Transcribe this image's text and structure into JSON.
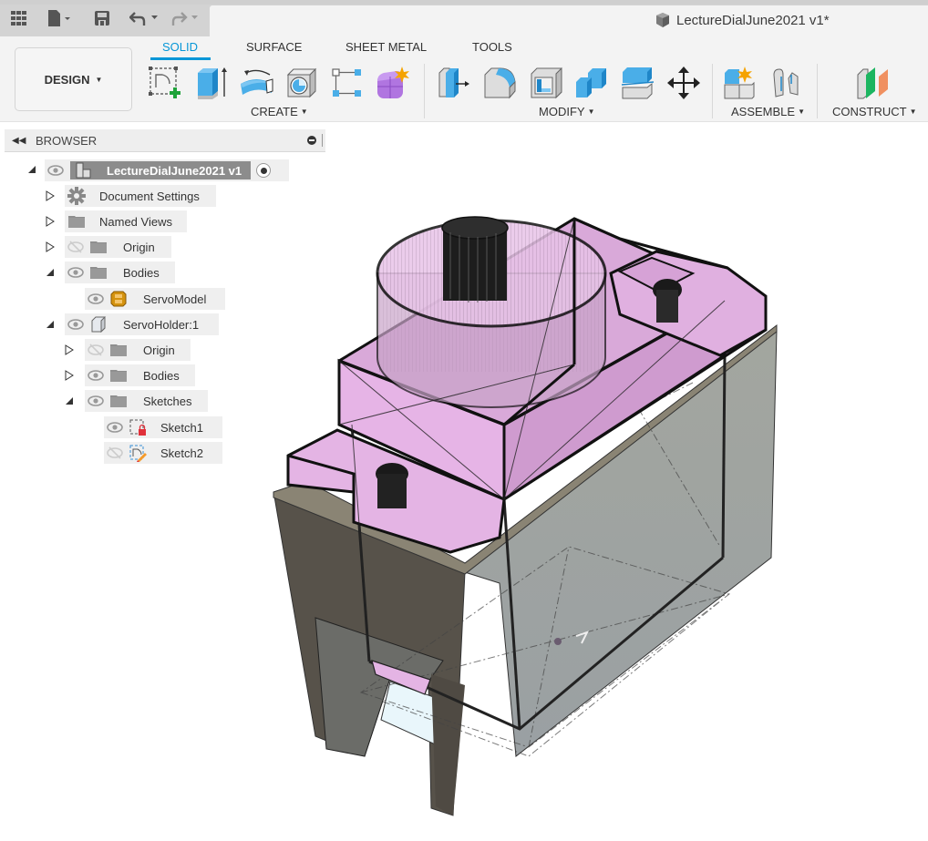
{
  "app": {
    "document_title": "LectureDialJune2021 v1*"
  },
  "quick_access": {
    "icons": [
      "grid-icon",
      "file-icon",
      "save-icon",
      "undo-icon",
      "redo-icon"
    ]
  },
  "workspace": {
    "label": "DESIGN"
  },
  "tabs": [
    {
      "label": "SOLID",
      "active": true
    },
    {
      "label": "SURFACE",
      "active": false
    },
    {
      "label": "SHEET METAL",
      "active": false
    },
    {
      "label": "TOOLS",
      "active": false
    }
  ],
  "toolbar_groups": [
    {
      "label": "CREATE",
      "tools": [
        "create-sketch",
        "extrude",
        "revolve",
        "hole",
        "rectangular-pattern",
        "create-form"
      ]
    },
    {
      "label": "MODIFY",
      "tools": [
        "press-pull",
        "fillet",
        "shell",
        "combine",
        "split-body",
        "move-copy"
      ]
    },
    {
      "label": "ASSEMBLE",
      "tools": [
        "new-component",
        "joint"
      ]
    },
    {
      "label": "CONSTRUCT",
      "tools": [
        "offset-plane"
      ]
    }
  ],
  "colors": {
    "accent": "#0696d7",
    "tool_blue": "#4aaee8",
    "servo_pink": "#e8b8e8",
    "holder_gray": "#9a9d96",
    "holder_dark": "#5c574e"
  },
  "browser": {
    "title": "BROWSER",
    "root": {
      "label": "LectureDialJune2021 v1"
    },
    "items": [
      {
        "label": "Document Settings",
        "icon": "gear-icon",
        "expander": "collapsed",
        "eye": "none"
      },
      {
        "label": "Named Views",
        "icon": "folder-icon",
        "expander": "collapsed",
        "eye": "none"
      },
      {
        "label": "Origin",
        "icon": "folder-icon",
        "expander": "collapsed",
        "eye": "hidden"
      },
      {
        "label": "Bodies",
        "icon": "folder-icon",
        "expander": "expanded",
        "eye": "visible"
      },
      {
        "label": "ServoModel",
        "icon": "body-icon",
        "expander": "none",
        "eye": "visible"
      },
      {
        "label": "ServoHolder:1",
        "icon": "component-icon",
        "expander": "expanded",
        "eye": "visible"
      },
      {
        "label": "Origin",
        "icon": "folder-icon",
        "expander": "collapsed",
        "eye": "hidden"
      },
      {
        "label": "Bodies",
        "icon": "folder-icon",
        "expander": "collapsed",
        "eye": "visible"
      },
      {
        "label": "Sketches",
        "icon": "folder-icon",
        "expander": "expanded",
        "eye": "visible"
      },
      {
        "label": "Sketch1",
        "icon": "sketch-locked-icon",
        "expander": "none",
        "eye": "visible"
      },
      {
        "label": "Sketch2",
        "icon": "sketch-edit-icon",
        "expander": "none",
        "eye": "hidden"
      }
    ]
  }
}
